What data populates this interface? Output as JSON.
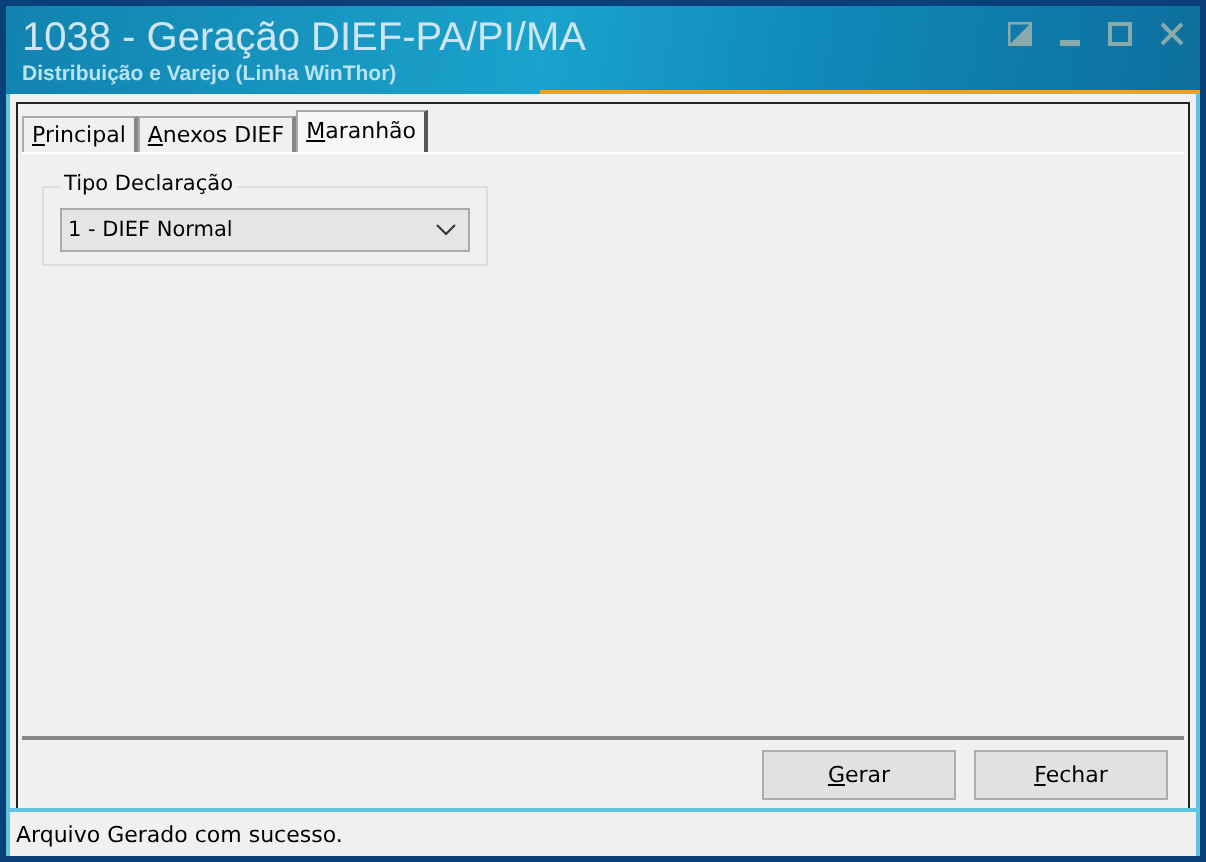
{
  "window": {
    "title": "1038 - Geração DIEF-PA/PI/MA",
    "subtitle": "Distribuição e Varejo (Linha WinThor)"
  },
  "tabs": [
    {
      "label": "Principal",
      "selected": false
    },
    {
      "label": "Anexos DIEF",
      "selected": false
    },
    {
      "label": "Maranhão",
      "selected": true
    }
  ],
  "group": {
    "title": "Tipo Declaração",
    "select": {
      "value": "1 - DIEF Normal"
    }
  },
  "buttons": [
    "Gerar",
    "Fechar"
  ],
  "status_bar": "Arquivo Gerado com sucesso."
}
